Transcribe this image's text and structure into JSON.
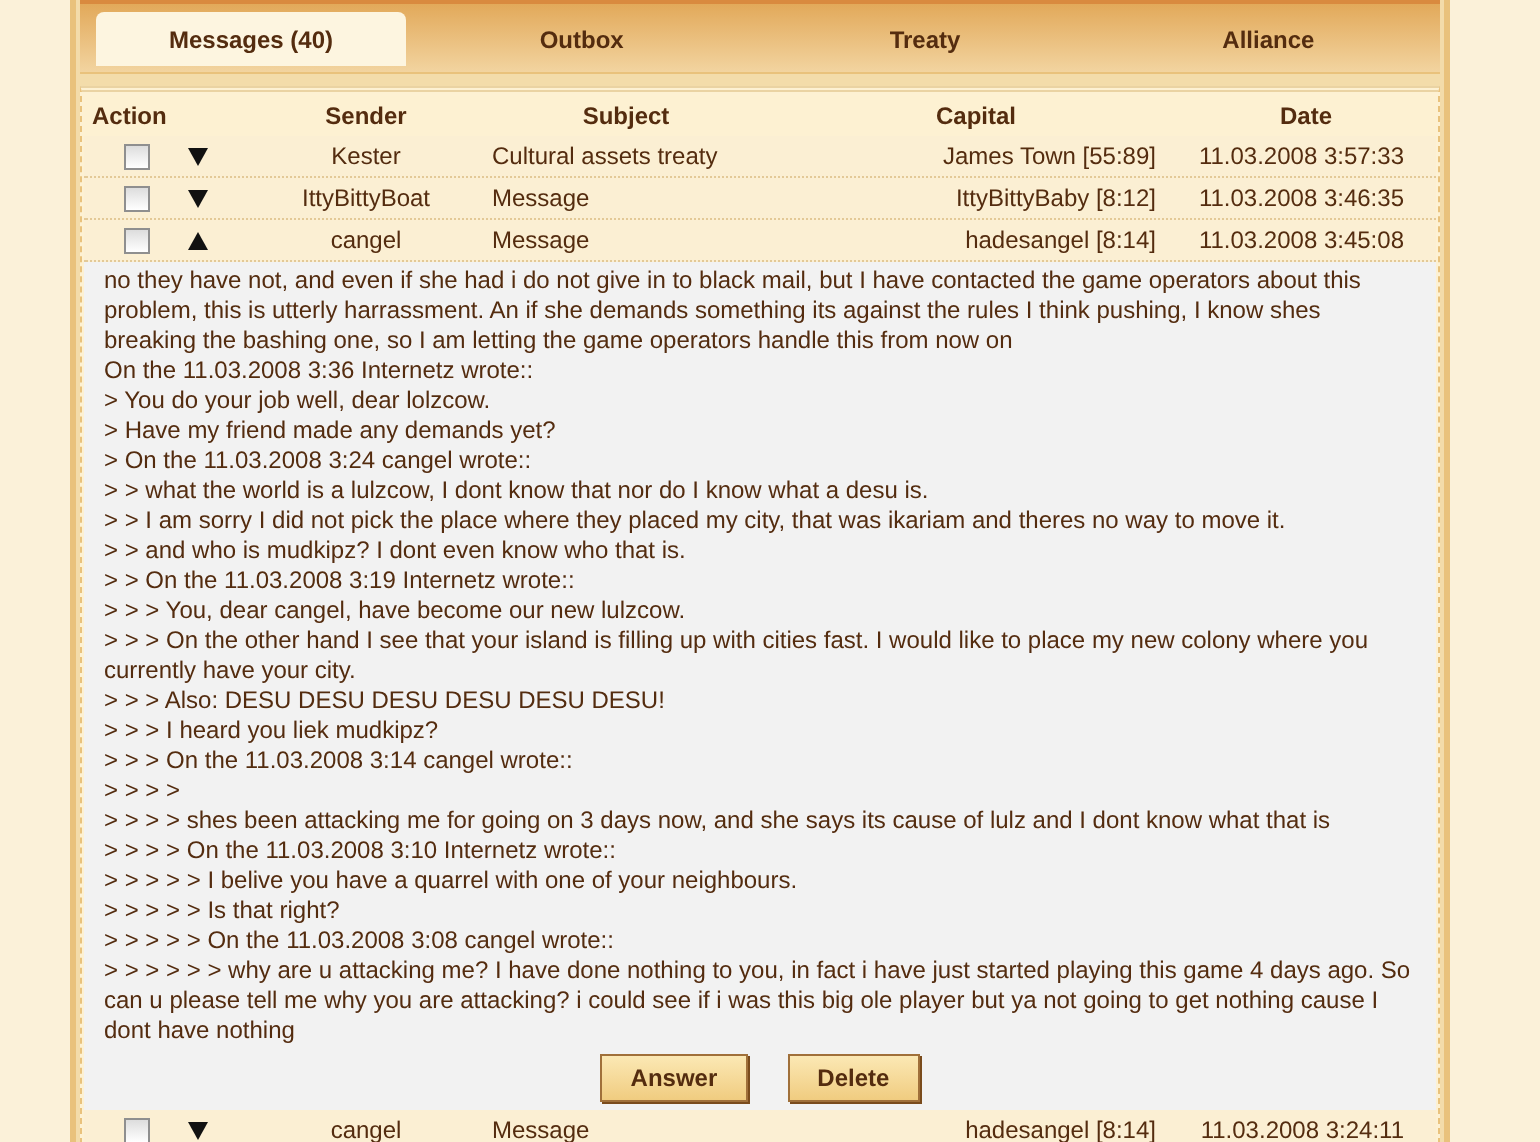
{
  "tabs": [
    {
      "label": "Messages (40)",
      "selected": true
    },
    {
      "label": "Outbox",
      "selected": false
    },
    {
      "label": "Treaty",
      "selected": false
    },
    {
      "label": "Alliance",
      "selected": false
    }
  ],
  "table": {
    "columns": [
      "Action",
      "Sender",
      "Subject",
      "Capital",
      "Date"
    ],
    "rows": [
      {
        "checked": false,
        "expanded": false,
        "sender": "Kester",
        "subject": "Cultural assets treaty",
        "capital": "James Town [55:89]",
        "date": "11.03.2008 3:57:33"
      },
      {
        "checked": false,
        "expanded": false,
        "sender": "IttyBittyBoat",
        "subject": "Message",
        "capital": "IttyBittyBaby [8:12]",
        "date": "11.03.2008 3:46:35"
      },
      {
        "checked": false,
        "expanded": true,
        "sender": "cangel",
        "subject": "Message",
        "capital": "hadesangel [8:14]",
        "date": "11.03.2008 3:45:08"
      }
    ],
    "message": {
      "lines": [
        "no they have not, and even if she had i do not give in to black mail, but I have contacted the game operators about this problem, this is utterly harrassment. An if she demands something its against the rules I think pushing, I know shes breaking the bashing one, so I am letting the game operators handle this from now on",
        "On the 11.03.2008 3:36 Internetz wrote::",
        "> You do your job well, dear lolzcow.",
        "> Have my friend made any demands yet?",
        "> On the 11.03.2008 3:24 cangel wrote::",
        "> > what the world is a lulzcow, I dont know that nor do I know what a desu is.",
        "> > I am sorry I did not pick the place where they placed my city, that was ikariam and theres no way to move it.",
        "> > and who is mudkipz? I dont even know who that is.",
        "> > On the 11.03.2008 3:19 Internetz wrote::",
        "> > > You, dear cangel, have become our new lulzcow.",
        "> > > On the other hand I see that your island is filling up with cities fast. I would like to place my new colony where you currently have your city.",
        "> > > Also: DESU DESU DESU DESU DESU DESU!",
        "> > > I heard you liek mudkipz?",
        "> > > On the 11.03.2008 3:14 cangel wrote::",
        "> > > >",
        "> > > > shes been attacking me for going on 3 days now, and she says its cause of lulz and I dont know what that is",
        "> > > > On the 11.03.2008 3:10 Internetz wrote::",
        "> > > > > I belive you have a quarrel with one of your neighbours.",
        "> > > > > Is that right?",
        "> > > > > On the 11.03.2008 3:08 cangel wrote::",
        "> > > > > > why are u attacking me? I have done nothing to you, in fact i have just started playing this game 4 days ago. So can u please tell me why you are attacking? i could see if i was this big ole player but ya not going to get nothing cause I dont have nothing"
      ],
      "buttons": [
        "Answer",
        "Delete"
      ]
    },
    "rows_after": [
      {
        "checked": false,
        "expanded": false,
        "sender": "cangel",
        "subject": "Message",
        "capital": "hadesangel [8:14]",
        "date": "11.03.2008 3:24:11"
      }
    ]
  }
}
